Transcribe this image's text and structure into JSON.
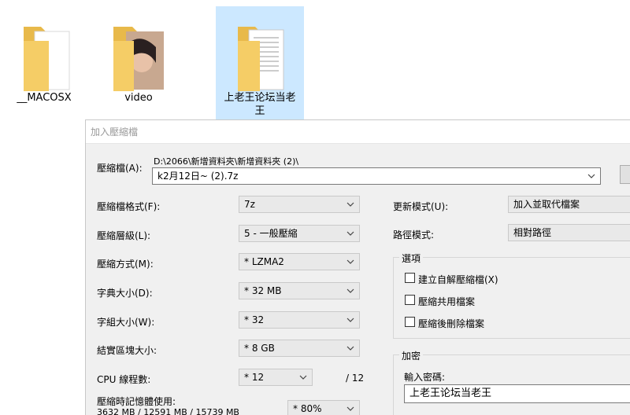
{
  "desktop": {
    "folders": [
      {
        "label": "__MACOSX"
      },
      {
        "label": "video"
      },
      {
        "label": "上老王论坛当老王"
      }
    ]
  },
  "dialog": {
    "title": "加入壓縮檔",
    "archive": {
      "label": "壓縮檔(A):",
      "path": "D:\\2066\\新增資料夾\\新增資料夾 (2)\\",
      "filename": "k2月12日~ (2).7z",
      "browse_label": "..."
    },
    "format": {
      "label": "壓縮檔格式(F):",
      "value": "7z"
    },
    "level": {
      "label": "壓縮層級(L):",
      "value": "5 - 一般壓縮"
    },
    "method": {
      "label": "壓縮方式(M):",
      "value": "* LZMA2"
    },
    "dictionary": {
      "label": "字典大小(D):",
      "value": "* 32 MB"
    },
    "word": {
      "label": "字組大小(W):",
      "value": "* 32"
    },
    "solid": {
      "label": "結實區塊大小:",
      "value": "* 8 GB"
    },
    "threads": {
      "label": "CPU 線程數:",
      "value": "* 12",
      "max": "/ 12"
    },
    "memory": {
      "label": "壓縮時記憶體使用:",
      "detail": "3632 MB / 12591 MB / 15739 MB",
      "value": "* 80%"
    },
    "update_mode": {
      "label": "更新模式(U):",
      "value": "加入並取代檔案"
    },
    "path_mode": {
      "label": "路徑模式:",
      "value": "相對路徑"
    },
    "options": {
      "title": "選項",
      "sfx": "建立自解壓縮檔(X)",
      "shared": "壓縮共用檔案",
      "delete": "壓縮後刪除檔案"
    },
    "encryption": {
      "title": "加密",
      "password_label": "輸入密碼:",
      "password_value": "上老王论坛当老王"
    }
  }
}
